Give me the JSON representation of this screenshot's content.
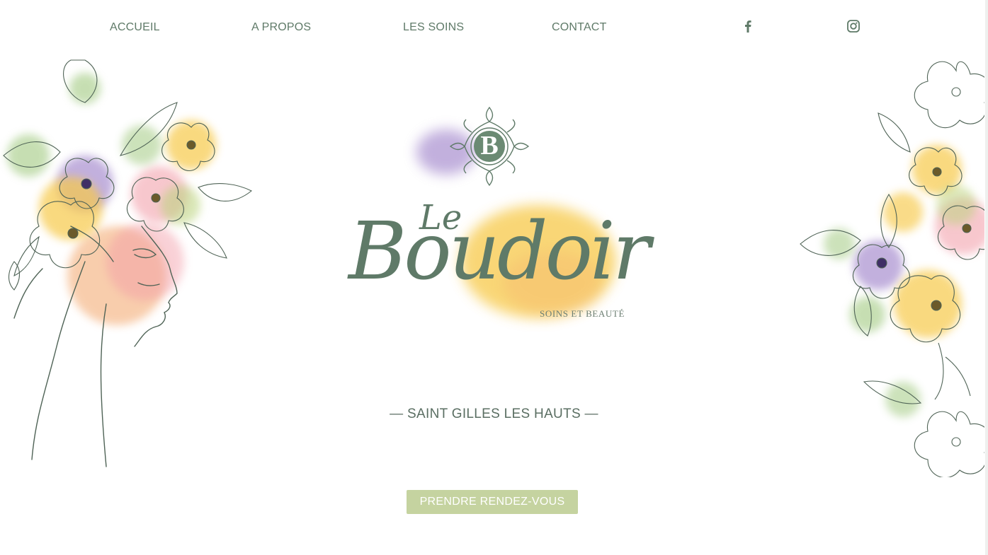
{
  "nav": {
    "items": [
      {
        "label": "ACCUEIL"
      },
      {
        "label": "A PROPOS"
      },
      {
        "label": "LES SOINS"
      },
      {
        "label": "CONTACT"
      }
    ],
    "social": [
      "facebook-icon",
      "instagram-icon"
    ]
  },
  "logo": {
    "monogram": "B",
    "small_word": "Le",
    "main_word": "Boudoir",
    "tagline": "SOINS ET BEAUTÉ"
  },
  "hero": {
    "location": "— SAINT GILLES LES HAUTS —",
    "cta_label": "PRENDRE RENDEZ-VOUS"
  },
  "colors": {
    "brand_green": "#5f7a68",
    "cta_bg": "#c5d3a0",
    "watercolor_yellow": "#f7c94a",
    "watercolor_purple": "#9a7cc7",
    "watercolor_pink": "#f29aa6",
    "watercolor_orange": "#f3a66b"
  }
}
